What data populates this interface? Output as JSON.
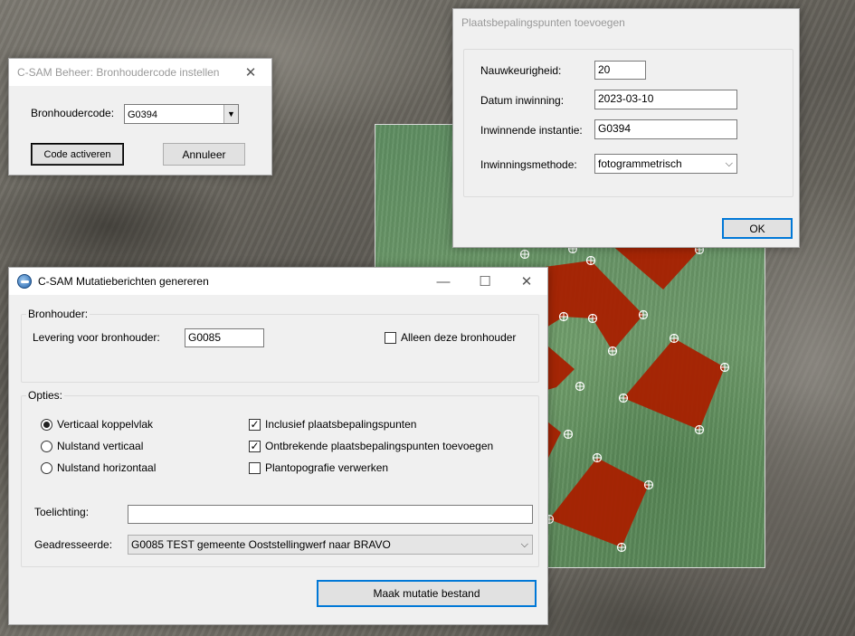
{
  "bronhoudercode_dialog": {
    "title": "C-SAM Beheer: Bronhoudercode instellen",
    "close_glyph": "✕",
    "code_label": "Bronhoudercode:",
    "code_value": "G0394",
    "activate_button": "Code activeren",
    "cancel_button": "Annuleer"
  },
  "plaatsbepaling_dialog": {
    "title": "Plaatsbepalingspunten toevoegen",
    "fields": [
      {
        "label": "Nauwkeurigheid:",
        "value": "20"
      },
      {
        "label": "Datum inwinning:",
        "value": "2023-03-10"
      },
      {
        "label": "Inwinnende instantie:",
        "value": "G0394"
      },
      {
        "label": "Inwinningsmethode:",
        "value": "fotogrammetrisch"
      }
    ],
    "ok_button": "OK"
  },
  "mutatie_dialog": {
    "title": "C-SAM Mutatieberichten genereren",
    "minimize_glyph": "—",
    "maximize_glyph": "☐",
    "close_glyph": "✕",
    "bronhouder_group": "Bronhouder:",
    "levering_label": "Levering voor bronhouder:",
    "levering_value": "G0085",
    "alleen_label": "Alleen deze bronhouder",
    "alleen_checked": false,
    "opties_group": "Opties:",
    "radios": [
      {
        "label": "Verticaal koppelvlak",
        "checked": true
      },
      {
        "label": "Nulstand verticaal",
        "checked": false
      },
      {
        "label": "Nulstand horizontaal",
        "checked": false
      }
    ],
    "checkboxes": [
      {
        "label": "Inclusief plaatsbepalingspunten",
        "checked": true
      },
      {
        "label": "Ontbrekende plaatsbepalingspunten toevoegen",
        "checked": true
      },
      {
        "label": "Plantopografie verwerken",
        "checked": false
      }
    ],
    "toelichting_label": "Toelichting:",
    "toelichting_value": "",
    "geadresseerde_label": "Geadresseerde:",
    "geadresseerde_value": "G0085 TEST gemeente Ooststellingwerf naar BRAVO",
    "make_button": "Maak mutatie bestand"
  },
  "colors": {
    "polygon_fill": "#a82000",
    "accent_blue": "#0078d7"
  },
  "icons": {
    "app": "c-sam-app-icon",
    "point_marker": "crosshair-point-icon",
    "dropdown": "chevron-down-icon",
    "check": "checkmark-icon"
  }
}
